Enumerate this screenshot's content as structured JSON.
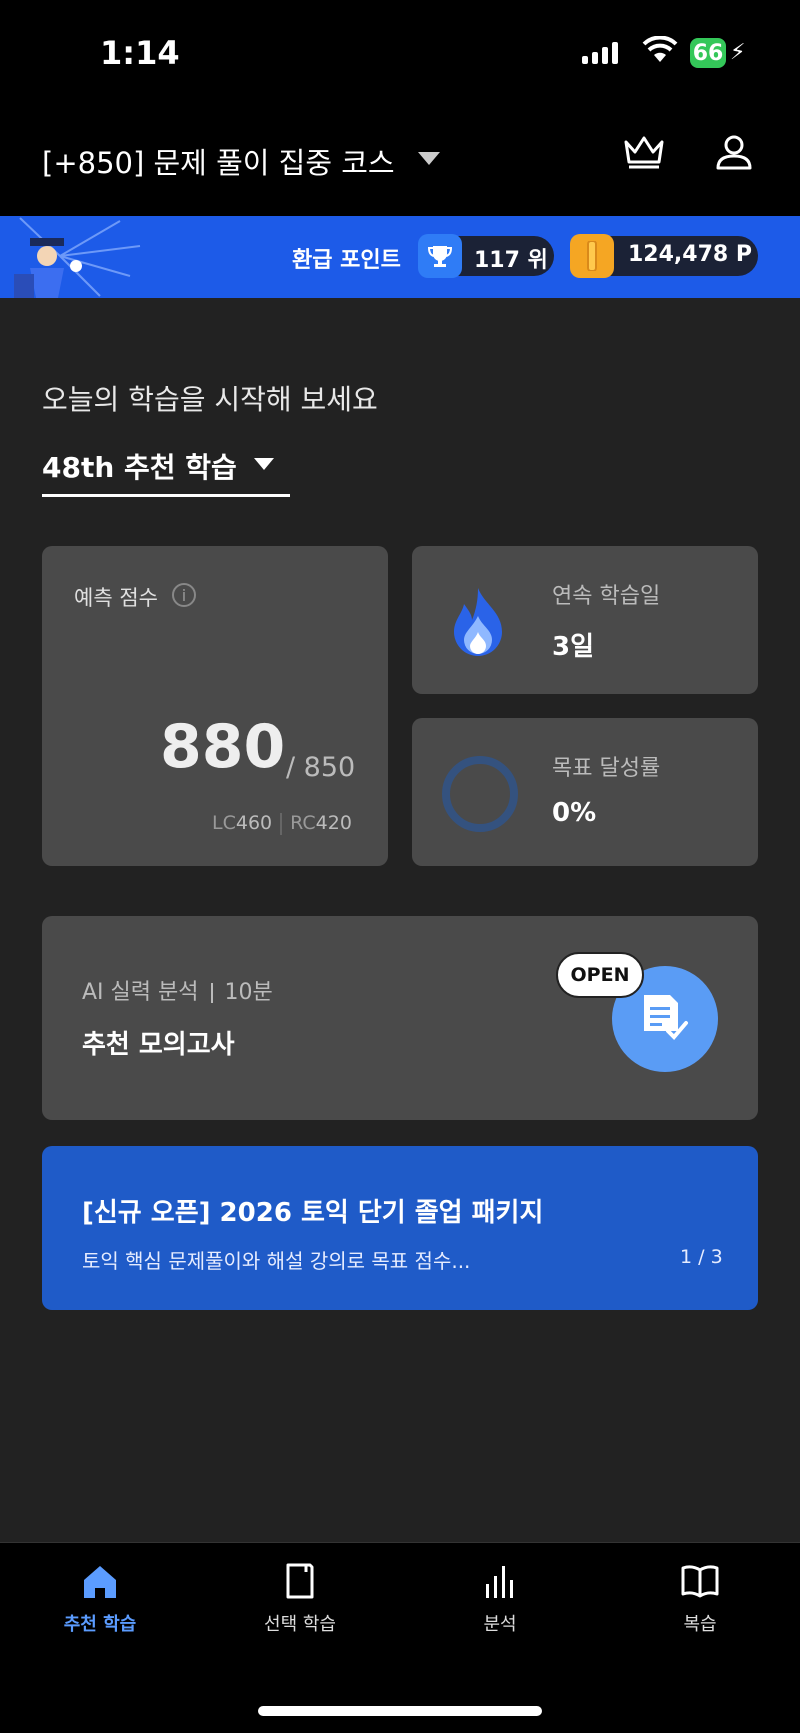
{
  "status": {
    "time": "1:14",
    "battery": "66"
  },
  "header": {
    "course_title": "[+850] 문제 풀이 집중 코스"
  },
  "banner": {
    "label": "환급 포인트",
    "rank": "117 위",
    "points": "124,478 P"
  },
  "main": {
    "greeting": "오늘의 학습을 시작해 보세요",
    "study_select": "48th 추천 학습",
    "score": {
      "label": "예측 점수",
      "value": "880",
      "target": "/ 850",
      "lc_label": "LC",
      "lc": "460",
      "rc_label": "RC",
      "rc": "420"
    },
    "streak": {
      "label": "연속 학습일",
      "value": "3일"
    },
    "goal": {
      "label": "목표 달성률",
      "value": "0%",
      "progress": 0
    },
    "mock": {
      "subtitle": "AI 실력 분석",
      "duration": "10분",
      "title": "추천 모의고사",
      "badge": "OPEN"
    },
    "promo": {
      "title": "[신규 오픈] 2026 토익 단기 졸업 패키지",
      "desc": "토익 핵심 문제풀이와 해설 강의로 목표 점수...",
      "page": "1 / 3"
    }
  },
  "nav": [
    {
      "label": "추천 학습",
      "icon": "home-icon",
      "active": true
    },
    {
      "label": "선택 학습",
      "icon": "book-icon",
      "active": false
    },
    {
      "label": "분석",
      "icon": "chart-icon",
      "active": false
    },
    {
      "label": "복습",
      "icon": "open-book-icon",
      "active": false
    }
  ],
  "colors": {
    "accent": "#5b9cff",
    "banner": "#1d5be8",
    "card": "#4a4a4a",
    "promo": "#1f5bc8",
    "background": "#222222"
  }
}
